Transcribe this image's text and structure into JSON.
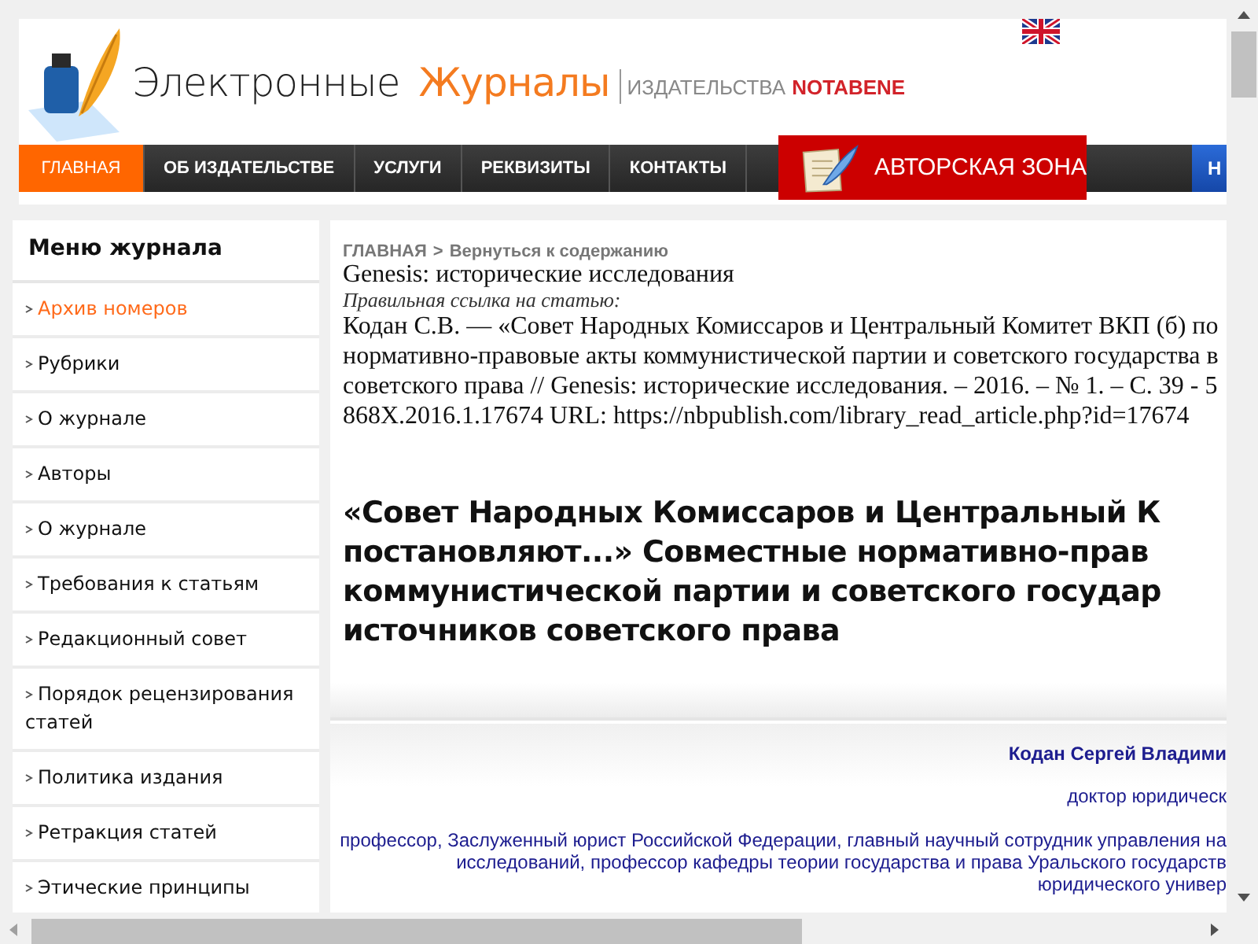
{
  "header": {
    "logo_word_1": "Электронные",
    "logo_word_2": "Журналы",
    "publisher_prefix": "ИЗДАТЕЛЬСТВА",
    "publisher_name": "NOTABENE"
  },
  "nav": [
    {
      "label": "ГЛАВНАЯ",
      "selected": true
    },
    {
      "label": "ОБ ИЗДАТЕЛЬСТВЕ",
      "selected": false
    },
    {
      "label": "УСЛУГИ",
      "selected": false
    },
    {
      "label": "РЕКВИЗИТЫ",
      "selected": false
    },
    {
      "label": "КОНТАКТЫ",
      "selected": false
    }
  ],
  "author_zone_button": "АВТОРСКАЯ ЗОНА",
  "nav_cut_item": "Н",
  "sidebar": {
    "title": "Меню журнала",
    "items": [
      {
        "label": "Архив номеров",
        "selected": true
      },
      {
        "label": "Рубрики",
        "selected": false
      },
      {
        "label": "О журнале",
        "selected": false
      },
      {
        "label": "Авторы",
        "selected": false
      },
      {
        "label": "О журнале",
        "selected": false
      },
      {
        "label": "Требования к статьям",
        "selected": false
      },
      {
        "label": "Редакционный совет",
        "selected": false
      },
      {
        "label": "Порядок рецензирования статей",
        "selected": false
      },
      {
        "label": "Политика издания",
        "selected": false
      },
      {
        "label": "Ретракция статей",
        "selected": false
      },
      {
        "label": "Этические принципы",
        "selected": false
      }
    ]
  },
  "breadcrumb": {
    "items": [
      "ГЛАВНАЯ",
      "Вернуться к содержанию"
    ],
    "separator": ">"
  },
  "journal_name": "Genesis: исторические исследования",
  "citation_label": "Правильная ссылка на статью:",
  "citation_lines": [
    "Кодан С.В. — «Совет Народных Комиссаров и Центральный Комитет ВКП (б) по",
    "нормативно-правовые акты коммунистической партии и советского государства в",
    "советского права // Genesis: исторические исследования. – 2016. – № 1. – С. 39 - 5",
    "868X.2016.1.17674 URL: https://nbpublish.com/library_read_article.php?id=17674"
  ],
  "article_title_lines": [
    "«Совет Народных Комиссаров и Центральный К",
    "постановляют...» Совместные нормативно-прав",
    "коммунистической партии и советского государ",
    "источников советского права"
  ],
  "author": {
    "name": "Кодан Сергей Владими",
    "degree": "доктор юридическ",
    "position_lines": [
      "профессор, Заслуженный юрист Российской Федерации, главный научный сотрудник управления на",
      "исследований, профессор кафедры теории государства и права Уральского государств",
      "юридического универ"
    ]
  }
}
